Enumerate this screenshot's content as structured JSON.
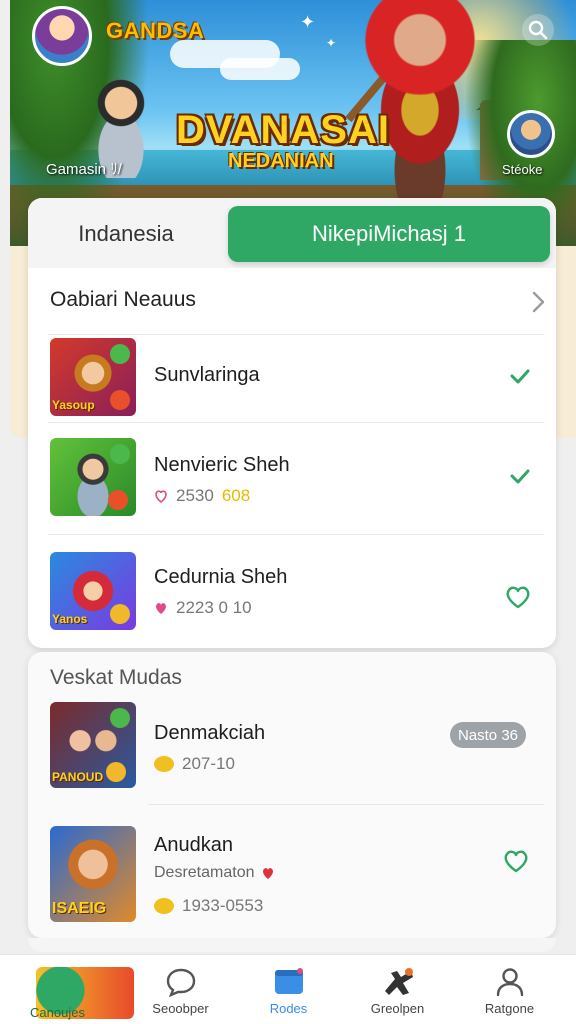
{
  "hero": {
    "brand": "GANDSA",
    "title_main": "DVANASAI",
    "title_sub": "NEDANIAN",
    "left_caption": "Gamasin ﾘ/",
    "right_caption": "Stéoke"
  },
  "tabs": [
    {
      "label": "Indanesia",
      "active": false
    },
    {
      "label": "NikepiMichasj 1",
      "active": true
    }
  ],
  "section1": {
    "title": "Oabiari Neauus",
    "items": [
      {
        "name": "Sunvlaringa",
        "meta_icon": "heart-icon",
        "meta_value": "",
        "meta_highlight": "",
        "action_icon": "checkmark-icon",
        "thumb_tag": "Yasoup"
      },
      {
        "name": "Nenvieric Sheh",
        "meta_icon": "heart-icon",
        "meta_value": "2530",
        "meta_highlight": "608",
        "action_icon": "checkmark-icon",
        "thumb_tag": ""
      },
      {
        "name": "Cedurnia Sheh",
        "meta_icon": "heart-icon",
        "meta_value": "2223 0 10",
        "meta_highlight": "",
        "action_icon": "heart-outline-icon",
        "thumb_tag": "Yanos"
      }
    ]
  },
  "section2": {
    "title": "Veskat Mudas",
    "items": [
      {
        "name": "Denmakciah",
        "meta_icon": "coin-icon",
        "meta_value": "207-10",
        "badge": "Nasto 36",
        "thumb_tag": "PANOUD"
      },
      {
        "name": "Anudkan",
        "sub": "Desretamaton",
        "meta_icon": "coin-icon",
        "meta_value": "1933-0553",
        "action_icon": "heart-outline-icon",
        "thumb_tag": "ISAEIG"
      }
    ]
  },
  "nav": [
    {
      "label": "Canoujes",
      "icon": "home-art-icon",
      "active": true
    },
    {
      "label": "Seoobper",
      "icon": "chat-bubble-icon",
      "active": false
    },
    {
      "label": "Rodes",
      "icon": "window-icon",
      "active": false
    },
    {
      "label": "Greolpen",
      "icon": "game-controller-icon",
      "active": false
    },
    {
      "label": "Ratgone",
      "icon": "person-icon",
      "active": false
    }
  ],
  "colors": {
    "accent_green": "#2ea864",
    "badge_gray": "#9ea3a8",
    "nav_active_blue": "#3a8ee6",
    "title_gold": "#ffd21f"
  }
}
